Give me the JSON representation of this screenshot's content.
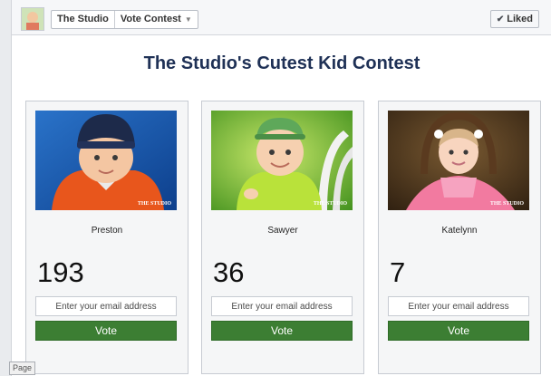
{
  "header": {
    "breadcrumb": [
      "The Studio",
      "Vote Contest"
    ],
    "liked_label": "Liked"
  },
  "contest": {
    "title": "The Studio's Cutest Kid Contest",
    "watermark": "THE STUDIO",
    "entries": [
      {
        "name": "Preston",
        "votes": "193",
        "email_placeholder": "Enter your email address",
        "vote_label": "Vote"
      },
      {
        "name": "Sawyer",
        "votes": "36",
        "email_placeholder": "Enter your email address",
        "vote_label": "Vote"
      },
      {
        "name": "Katelynn",
        "votes": "7",
        "email_placeholder": "Enter your email address",
        "vote_label": "Vote"
      }
    ]
  },
  "footer": {
    "page_tag": "Page"
  },
  "colors": {
    "vote_button": "#3c7e33",
    "title": "#1f3156"
  }
}
